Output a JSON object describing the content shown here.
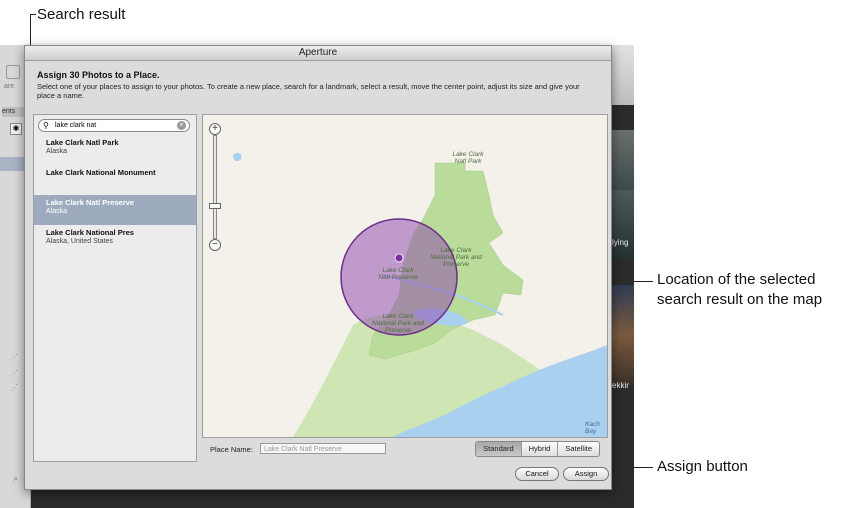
{
  "callouts": {
    "search_result": "Search result",
    "location_line1": "Location of the selected",
    "location_line2": "search result on the map",
    "assign_button": "Assign button"
  },
  "window": {
    "title": "Aperture"
  },
  "background": {
    "partial_tab_text": "ents",
    "partial_label": "are",
    "partial_text_1": "lying",
    "partial_text_2": "ekkir"
  },
  "dialog": {
    "heading": "Assign 30 Photos to a Place.",
    "instructions": "Select one of your places to assign to your photos. To create a new place, search for a landmark, select a result, move the center point, adjust its size and give your place a name.",
    "search": {
      "value": "lake clark nat"
    },
    "results": [
      {
        "title": "Lake Clark Natl Park",
        "subtitle": "Alaska",
        "selected": false
      },
      {
        "title": "Lake Clark National Monument",
        "subtitle": "",
        "selected": false
      },
      {
        "title": "Lake Clark Natl Preserve",
        "subtitle": "Alaska",
        "selected": true
      },
      {
        "title": "Lake Clark National Pres",
        "subtitle": "Alaska, United States",
        "selected": false
      }
    ],
    "map": {
      "labels": {
        "natl_park": "Lake Clark\nNatl Park",
        "np_and_preserve_1": "Lake Clark\nNational Park and\nPreserve",
        "natl_preserve": "Lake Clark\nNatl Preserve",
        "np_and_preserve_2": "Lake Clark\nNational Park and\nPreserve",
        "bay": "Kach\nBay"
      },
      "zoom_plus": "+",
      "zoom_minus": "−",
      "zoom_level": 0.62
    },
    "place_name": {
      "label": "Place Name:",
      "placeholder": "Lake Clark Natl Preserve"
    },
    "map_types": [
      "Standard",
      "Hybrid",
      "Satellite"
    ],
    "map_type_selected": "Standard",
    "cancel_label": "Cancel",
    "assign_label": "Assign"
  },
  "colors": {
    "land": "#cfe6b4",
    "park": "#b9dc9a",
    "water": "#a9d0ef",
    "selection": "#8e44ad",
    "selected_row": "#9eabbf"
  }
}
